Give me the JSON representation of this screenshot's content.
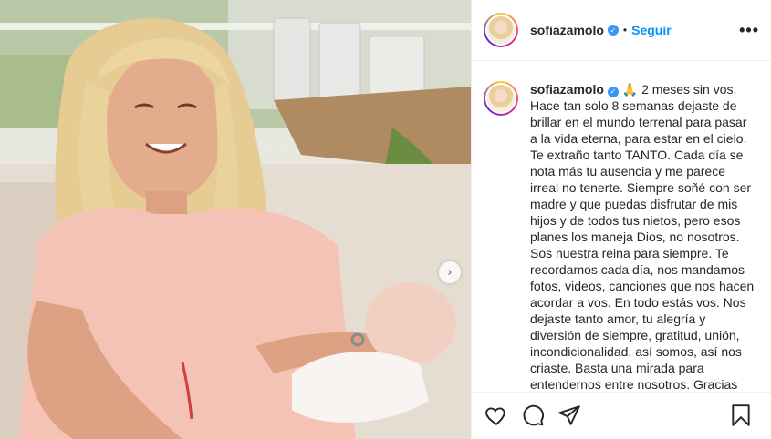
{
  "post": {
    "author": "sofiazamolo",
    "follow_label": "Seguir",
    "dot": "•",
    "more_label": "•••",
    "verified_mark": "✓"
  },
  "caption": {
    "author": "sofiazamolo",
    "emoji": "🙏",
    "text": "2 meses sin vos. Hace tan solo 8 semanas dejaste de brillar en el mundo terrenal para pasar a la vida eterna, para estar en el cielo. Te extraño tanto TANTO. Cada día se nota más tu ausencia y me parece irreal no tenerte. Siempre soñé con ser madre y que puedas disfrutar de mis hijos y de todos tus nietos, pero esos planes los maneja Dios, no nosotros. Sos nuestra reina para siempre. Te recordamos cada día, nos mandamos fotos, videos, canciones que nos hacen acordar a vos. En todo estás vos. Nos dejaste tanto amor, tu alegría y diversión de siempre, gratitud, unión, incondicionalidad, así somos, así nos criaste. Basta una mirada para entendernos entre nosotros. Gracias"
  },
  "carousel": {
    "next_glyph": "›"
  },
  "likes_peek": "... ... ... ..."
}
